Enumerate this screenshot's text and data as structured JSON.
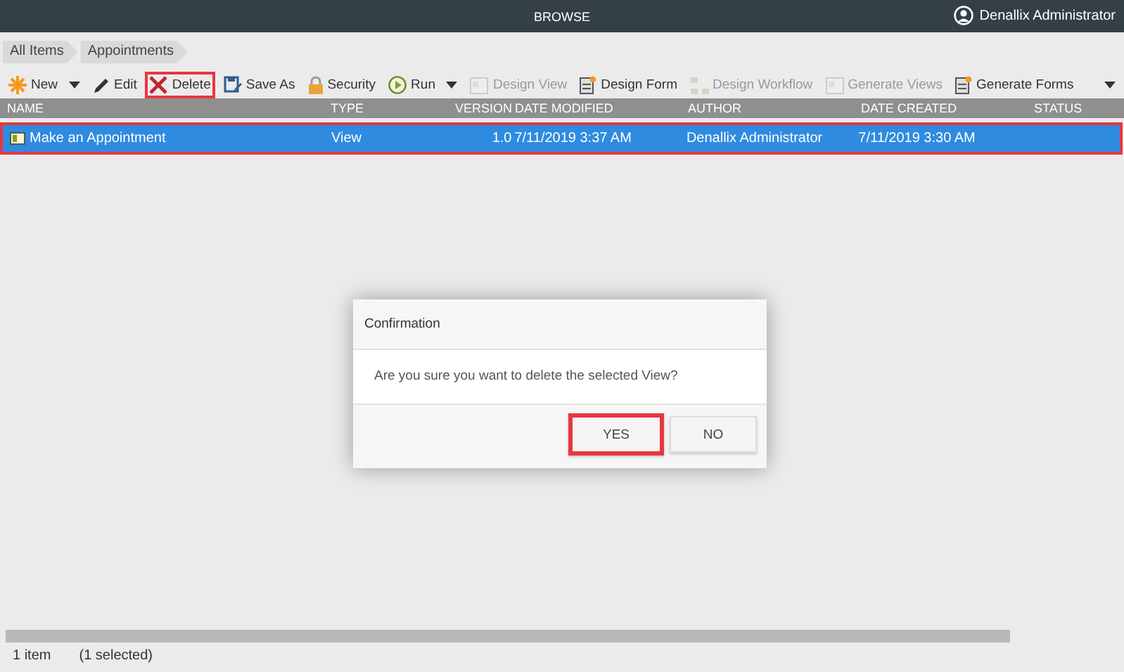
{
  "top_bar": {
    "title": "BROWSE",
    "user": "Denallix Administrator"
  },
  "breadcrumb": [
    "All Items",
    "Appointments"
  ],
  "toolbar": [
    {
      "label": "New",
      "kind": "new",
      "dropdown": true,
      "disabled": false,
      "highlighted": false
    },
    {
      "label": "Edit",
      "kind": "edit",
      "dropdown": false,
      "disabled": false,
      "highlighted": false
    },
    {
      "label": "Delete",
      "kind": "delete",
      "dropdown": false,
      "disabled": false,
      "highlighted": true
    },
    {
      "label": "Save As",
      "kind": "save",
      "dropdown": false,
      "disabled": false,
      "highlighted": false
    },
    {
      "label": "Security",
      "kind": "lock",
      "dropdown": false,
      "disabled": false,
      "highlighted": false
    },
    {
      "label": "Run",
      "kind": "run",
      "dropdown": true,
      "disabled": false,
      "highlighted": false
    },
    {
      "label": "Design View",
      "kind": "design",
      "dropdown": false,
      "disabled": true,
      "highlighted": false
    },
    {
      "label": "Design Form",
      "kind": "form",
      "dropdown": false,
      "disabled": false,
      "highlighted": false
    },
    {
      "label": "Design Workflow",
      "kind": "workflow",
      "dropdown": false,
      "disabled": true,
      "highlighted": false
    },
    {
      "label": "Generate Views",
      "kind": "design",
      "dropdown": false,
      "disabled": true,
      "highlighted": false
    },
    {
      "label": "Generate Forms",
      "kind": "form",
      "dropdown": false,
      "disabled": false,
      "highlighted": false
    }
  ],
  "table": {
    "columns": [
      "NAME",
      "TYPE",
      "VERSION",
      "DATE MODIFIED",
      "AUTHOR",
      "DATE CREATED",
      "STATUS"
    ],
    "rows": [
      {
        "selected": true,
        "highlighted": true,
        "cells": [
          "Make an Appointment",
          "View",
          "1.0",
          "7/11/2019 3:37 AM",
          "Denallix Administrator",
          "7/11/2019 3:30 AM",
          ""
        ]
      }
    ]
  },
  "dialog": {
    "title": "Confirmation",
    "message": "Are you sure you want to delete the selected View?",
    "buttons": [
      {
        "label": "YES",
        "highlighted": true
      },
      {
        "label": "NO",
        "highlighted": false
      }
    ]
  },
  "status_bar": [
    "1 item",
    "(1 selected)"
  ]
}
